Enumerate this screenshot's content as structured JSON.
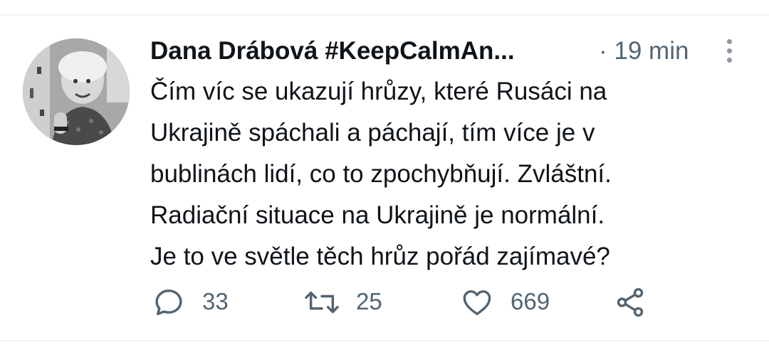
{
  "tweet": {
    "author": {
      "display_name": "Dana Drábová #KeepCalmAn...",
      "avatar_icon": "profile-photo"
    },
    "timestamp": "· 19 min",
    "text_lines": [
      "Čím víc se ukazují hrůzy, které Rusáci na",
      "Ukrajině spáchali a páchají, tím více je v",
      "bublinách lidí, co to zpochybňují. Zvláštní.",
      "Radiační situace na Ukrajině je normální.",
      "Je to ve světle těch hrůz pořád zajímavé?"
    ],
    "actions": {
      "reply_count": "33",
      "retweet_count": "25",
      "like_count": "669"
    },
    "icons": {
      "more": "more-vertical-icon",
      "reply": "reply-icon",
      "retweet": "retweet-icon",
      "like": "heart-icon",
      "share": "share-icon"
    },
    "colors": {
      "text": "#0f1419",
      "secondary": "#536471",
      "divider": "#eff3f4"
    }
  }
}
